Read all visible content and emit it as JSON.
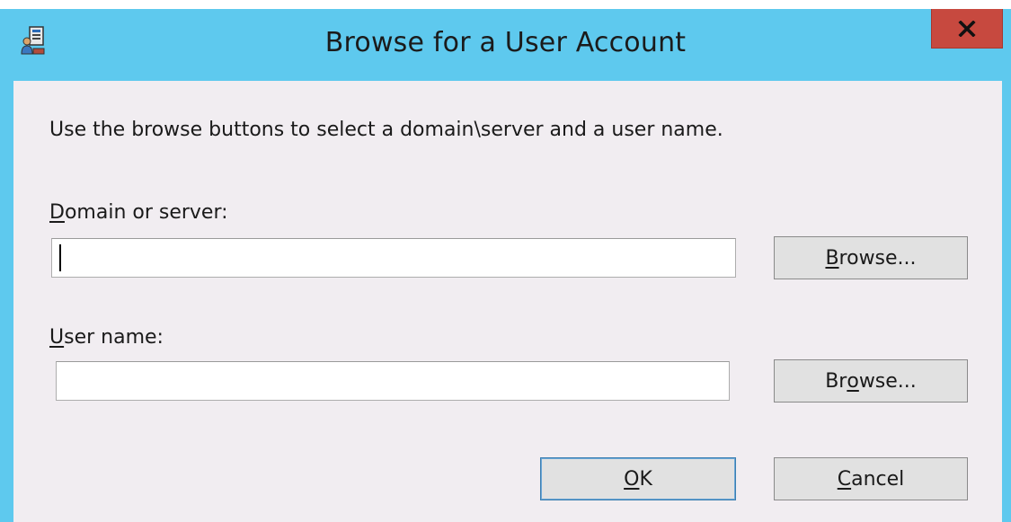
{
  "window": {
    "title": "Browse for a User Account",
    "close_glyph": "x",
    "icon": "users-computer-icon",
    "colors": {
      "title_bar": "#5ec9ee",
      "close_button": "#c7493f",
      "client_background": "#f1edf1"
    }
  },
  "instruction": "Use the browse buttons to select a domain\\server and a user name.",
  "domain": {
    "label_mnemonic": "D",
    "label_rest": "omain or server:",
    "value": "",
    "browse_pre": "",
    "browse_mnemonic": "B",
    "browse_post": "rowse..."
  },
  "user": {
    "label_mnemonic": "U",
    "label_rest": "ser name:",
    "value": "",
    "browse_pre": "Br",
    "browse_mnemonic": "o",
    "browse_post": "wse..."
  },
  "buttons": {
    "ok_mnemonic": "O",
    "ok_rest": "K",
    "cancel_mnemonic": "C",
    "cancel_rest": "ancel"
  }
}
